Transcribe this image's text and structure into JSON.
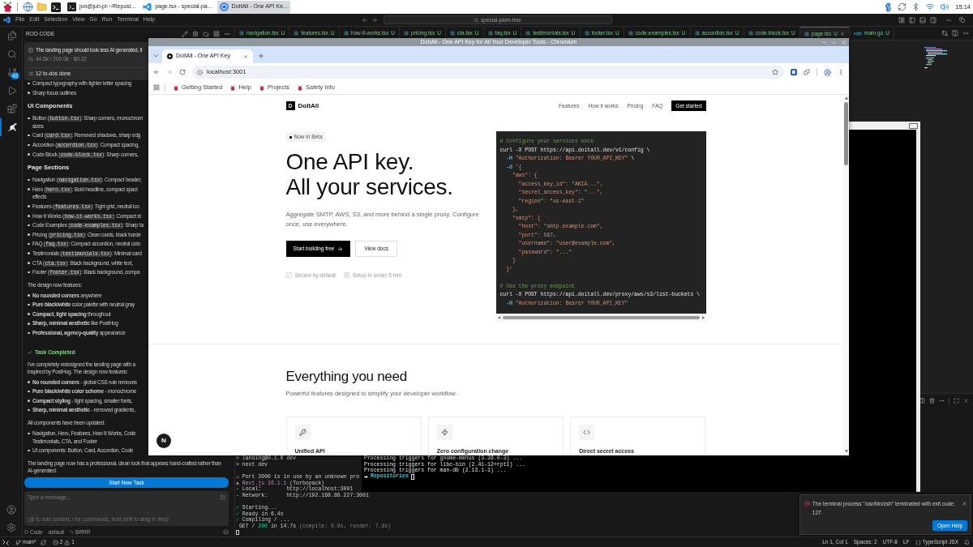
{
  "taskbar": {
    "windows": [
      {
        "kind": "terminal",
        "title": "jun@jun-pi:~/Reposi...",
        "selected": false
      },
      {
        "kind": "editor",
        "title": "page.tsx - special-pa...",
        "selected": false
      },
      {
        "kind": "browser",
        "title": "DoItAll - One API Ke...",
        "selected": true
      }
    ],
    "clock": "15:14"
  },
  "editor": {
    "menu": [
      "File",
      "Edit",
      "Selection",
      "View",
      "Go",
      "Run",
      "Terminal",
      "Help"
    ],
    "search": "special-palm-tree",
    "activity": [
      {
        "kind": "files",
        "selected": false
      },
      {
        "kind": "search",
        "selected": false
      },
      {
        "kind": "source-control",
        "selected": false,
        "badge": "45"
      },
      {
        "kind": "run",
        "selected": false
      },
      {
        "kind": "extensions",
        "selected": false
      },
      {
        "kind": "roo",
        "selected": true
      }
    ],
    "tabs": [
      {
        "kind": "tsx",
        "label": "navigation.tsx",
        "status": "U",
        "selected": false
      },
      {
        "kind": "tsx",
        "label": "features.tsx",
        "status": "U",
        "selected": false
      },
      {
        "kind": "tsx",
        "label": "how-it-works.tsx",
        "status": "U",
        "selected": false
      },
      {
        "kind": "tsx",
        "label": "pricing.tsx",
        "status": "U",
        "selected": false
      },
      {
        "kind": "tsx",
        "label": "cta.tsx",
        "status": "U",
        "selected": false
      },
      {
        "kind": "tsx",
        "label": "faq.tsx",
        "status": "U",
        "selected": false
      },
      {
        "kind": "tsx",
        "label": "testimonials.tsx",
        "status": "U",
        "selected": false
      },
      {
        "kind": "tsx",
        "label": "footer.tsx",
        "status": "U",
        "selected": false
      },
      {
        "kind": "tsx",
        "label": "code-examples.tsx",
        "status": "U",
        "selected": false
      },
      {
        "kind": "tsx",
        "label": "accordion.tsx",
        "status": "U",
        "selected": false
      },
      {
        "kind": "tsx",
        "label": "code-block.tsx",
        "status": "U",
        "selected": false
      },
      {
        "kind": "tsx",
        "label": "page.tsx",
        "status": "U",
        "selected": true
      },
      {
        "kind": "go",
        "label": "main.go",
        "status": "U",
        "selected": false
      }
    ]
  },
  "roo": {
    "title": "ROO CODE",
    "task": "The landing page should look less AI generated, it",
    "usage": "44.8k / 200.0k · $0.22",
    "todos": "12 to-dos done",
    "blocks": [
      {
        "kind": "bullet",
        "parts": [
          {
            "text": "Compact typography with tighter letter spacing"
          }
        ]
      },
      {
        "kind": "bullet",
        "parts": [
          {
            "text": "Sharp focus outlines"
          }
        ]
      },
      {
        "kind": "heading",
        "text": "UI Components"
      },
      {
        "kind": "bullet",
        "parts": [
          {
            "text": "Button ("
          },
          {
            "code": "button.tsx"
          },
          {
            "text": "): Sharp corners, monochrom"
          }
        ],
        "more": "sizes"
      },
      {
        "kind": "bullet",
        "parts": [
          {
            "text": "Card ("
          },
          {
            "code": "card.tsx"
          },
          {
            "text": "): Removed shadows, sharp edg"
          }
        ]
      },
      {
        "kind": "bullet",
        "parts": [
          {
            "text": "Accordion ("
          },
          {
            "code": "accordion.tsx"
          },
          {
            "text": "): Compact spacing,"
          }
        ]
      },
      {
        "kind": "bullet",
        "parts": [
          {
            "text": "Code Block ("
          },
          {
            "code": "code-block.tsx"
          },
          {
            "text": "): Sharp corners,"
          }
        ]
      },
      {
        "kind": "heading",
        "text": "Page Sections"
      },
      {
        "kind": "bullet",
        "parts": [
          {
            "text": "Navigation ("
          },
          {
            "code": "navigation.tsx"
          },
          {
            "text": "): Compact header,"
          }
        ]
      },
      {
        "kind": "bullet",
        "parts": [
          {
            "text": "Hero ("
          },
          {
            "code": "hero.tsx"
          },
          {
            "text": "): Bold headline, compact spaci"
          }
        ],
        "more": "effects"
      },
      {
        "kind": "bullet",
        "parts": [
          {
            "text": "Features ("
          },
          {
            "code": "features.tsx"
          },
          {
            "text": "): Tight grid, neutral ico"
          }
        ]
      },
      {
        "kind": "bullet",
        "parts": [
          {
            "text": "How It Works ("
          },
          {
            "code": "how-it-works.tsx"
          },
          {
            "text": "): Compact st"
          }
        ]
      },
      {
        "kind": "bullet",
        "parts": [
          {
            "text": "Code Examples ("
          },
          {
            "code": "code-examples.tsx"
          },
          {
            "text": "): Sharp ta"
          }
        ]
      },
      {
        "kind": "bullet",
        "parts": [
          {
            "text": "Pricing ("
          },
          {
            "code": "pricing.tsx"
          },
          {
            "text": "): Clean cards, black borde"
          }
        ]
      },
      {
        "kind": "bullet",
        "parts": [
          {
            "text": "FAQ ("
          },
          {
            "code": "faq.tsx"
          },
          {
            "text": "): Compact accordion, neutral colo"
          }
        ]
      },
      {
        "kind": "bullet",
        "parts": [
          {
            "text": "Testimonials ("
          },
          {
            "code": "testimonials.tsx"
          },
          {
            "text": "): Minimal card"
          }
        ]
      },
      {
        "kind": "bullet",
        "parts": [
          {
            "text": "CTA ("
          },
          {
            "code": "cta.tsx"
          },
          {
            "text": "): Black background, white text,"
          }
        ]
      },
      {
        "kind": "bullet",
        "parts": [
          {
            "text": "Footer ("
          },
          {
            "code": "footer.tsx"
          },
          {
            "text": "): Black background, compa"
          }
        ]
      },
      {
        "kind": "paragraph",
        "text": "The design now features:"
      },
      {
        "kind": "bullet",
        "parts": [
          {
            "text": "**No rounded corners** anywhere"
          }
        ]
      },
      {
        "kind": "bullet",
        "parts": [
          {
            "text": "**Pure black/white** color palette with neutral gray"
          }
        ]
      },
      {
        "kind": "bullet",
        "parts": [
          {
            "text": "**Compact, tight spacing** throughout"
          }
        ]
      },
      {
        "kind": "bullet",
        "parts": [
          {
            "text": "**Sharp, minimal aesthetic** like PostHog"
          }
        ]
      },
      {
        "kind": "bullet",
        "parts": [
          {
            "text": "**Professional, agency-quality** appearance"
          }
        ]
      },
      {
        "kind": "status",
        "text": "Task Completed"
      },
      {
        "kind": "paragraph",
        "text": "I've completely redesigned the landing page with a",
        "more": "inspired by PostHog. The design now features:"
      },
      {
        "kind": "bullet",
        "parts": [
          {
            "text": "**No rounded corners** - global CSS rule removes"
          }
        ]
      },
      {
        "kind": "bullet",
        "parts": [
          {
            "text": "**Pure black/white color scheme** - monochrome"
          }
        ]
      },
      {
        "kind": "bullet",
        "parts": [
          {
            "text": "**Compact styling** - tight spacing, smaller fonts,"
          }
        ]
      },
      {
        "kind": "bullet",
        "parts": [
          {
            "text": "**Sharp, minimal aesthetic** - removed gradients,"
          }
        ]
      },
      {
        "kind": "paragraph",
        "text": "All components have been updated:"
      },
      {
        "kind": "bullet",
        "parts": [
          {
            "text": "Navigation, Hero, Features, How It Works, Code"
          }
        ],
        "more": "Testimonials, CTA, and Footer"
      },
      {
        "kind": "bullet",
        "parts": [
          {
            "text": "UI components: Button, Card, Accordion, Code"
          }
        ]
      },
      {
        "kind": "paragraph",
        "text": "The landing page now has a professional, clean look that appears hand-crafted rather than AI-generated."
      }
    ],
    "action": "Start New Task",
    "input": {
      "placeholder": "Type a message...",
      "hint": "(@ to add context, / for commands, hold shift to drag in files)"
    },
    "mode": "Code",
    "config": "default",
    "model": "BRRR"
  },
  "terminal": {
    "groups": [
      [
        [
          {
            "kind": "plain",
            "text": "> landing@0.1.0 dev"
          }
        ],
        [
          {
            "kind": "plain",
            "text": "> next dev"
          }
        ]
      ],
      [
        [
          {
            "kind": "warn",
            "text": "⚠"
          },
          {
            "kind": "plain",
            "text": " Port 3000 is in use by an unknown pro"
          }
        ],
        [
          {
            "kind": "accent",
            "text": "▲ Next.js 16.1.1"
          },
          {
            "kind": "plain",
            "text": " (Turbopack)"
          }
        ],
        [
          {
            "kind": "plain",
            "text": "- Local:        http://localhost:3001"
          }
        ],
        [
          {
            "kind": "plain",
            "text": "- Network:      http://192.168.86.227:3001"
          }
        ]
      ],
      [
        [
          {
            "kind": "ok",
            "text": "✓"
          },
          {
            "kind": "plain",
            "text": " Starting..."
          }
        ],
        [
          {
            "kind": "ok",
            "text": "✓"
          },
          {
            "kind": "plain",
            "text": " Ready in 6.4s"
          }
        ],
        [
          {
            "kind": "muted",
            "text": "○"
          },
          {
            "kind": "plain",
            "text": " Compiling / ..."
          }
        ],
        [
          {
            "kind": "plain",
            "text": " GET / "
          },
          {
            "kind": "ok",
            "text": "200"
          },
          {
            "kind": "plain",
            "text": " in 14.7s "
          },
          {
            "kind": "muted",
            "text": "(compile: 6.9s, render: 7.8s)"
          }
        ]
      ]
    ]
  },
  "notification": {
    "message": "The terminal process \"/usr/bin/zsh\" terminated with exit code: 127.",
    "button": "Open Help"
  },
  "status_bar": {
    "branch": "main*",
    "errors": "2",
    "warnings": "1",
    "items": [
      "Ln 1, Col 1",
      "Spaces: 2",
      "UTF-8",
      "LF"
    ],
    "language": "TypeScript JSX"
  },
  "terminal_window": {
    "lines": [
      "Processing triggers for gnome-menus (3.36.0-3) ...",
      "Processing triggers for libc-bin (2.41-12+rpt1) ...",
      "Processing triggers for man-db (2.13.1-1) ..."
    ],
    "prompt": "Repositories"
  },
  "browser": {
    "title": "DoItAll - One API Key for All Your Developer Tools - Chromium",
    "tab": "DoItAll - One API Key",
    "url": "localhost:3001",
    "bookmarks": [
      "Getting Started",
      "Help",
      "Projects",
      "Safety Info"
    ],
    "page": {
      "logo": "D",
      "brand": "DoItAll",
      "nav": [
        "Features",
        "How it works",
        "Pricing",
        "FAQ"
      ],
      "cta": "Get started",
      "badge": "Now in Beta",
      "headline": [
        "One API key.",
        "All your services."
      ],
      "lead": "Aggregate SMTP, AWS, S3, and more behind a single proxy. Configure once, use everywhere.",
      "buttons": [
        {
          "kind": "primary",
          "label": "Start building free"
        },
        {
          "kind": "secondary",
          "label": "View docs"
        }
      ],
      "checks": [
        {
          "kind": "check",
          "text": "Secure by default"
        },
        {
          "kind": "bolt",
          "text": "Setup in under 5 min"
        }
      ],
      "code": [
        [
          [
            {
              "kind": "comment",
              "text": "# Configure your services once"
            }
          ],
          [
            {
              "kind": "plain",
              "text": "curl -X POST https://api.doitall.dev/v1/config \\"
            }
          ],
          [
            {
              "kind": "flag",
              "text": "  -H "
            },
            {
              "kind": "string",
              "text": "\"Authorization: Bearer YOUR_API_KEY\""
            },
            {
              "kind": "plain",
              "text": " \\"
            }
          ],
          [
            {
              "kind": "flag",
              "text": "  -d "
            },
            {
              "kind": "string",
              "text": "'{"
            }
          ],
          [
            {
              "kind": "string",
              "text": "    \"aws\": {"
            }
          ],
          [
            {
              "kind": "string",
              "text": "      \"access_key_id\": \"AKIA...\","
            }
          ],
          [
            {
              "kind": "string",
              "text": "      \"secret_access_key\": \"...\","
            }
          ],
          [
            {
              "kind": "string",
              "text": "      \"region\": \"us-east-1\""
            }
          ],
          [
            {
              "kind": "string",
              "text": "    },"
            }
          ],
          [
            {
              "kind": "string",
              "text": "    \"smtp\": {"
            }
          ],
          [
            {
              "kind": "string",
              "text": "      \"host\": \"smtp.example.com\","
            }
          ],
          [
            {
              "kind": "string",
              "text": "      \"port\": 587,"
            }
          ],
          [
            {
              "kind": "string",
              "text": "      \"username\": \"user@example.com\","
            }
          ],
          [
            {
              "kind": "string",
              "text": "      \"password\": \"...\""
            }
          ],
          [
            {
              "kind": "string",
              "text": "    }"
            }
          ],
          [
            {
              "kind": "string",
              "text": "  }'"
            }
          ]
        ],
        [
          [
            {
              "kind": "comment",
              "text": "# Use the proxy endpoint"
            }
          ],
          [
            {
              "kind": "plain",
              "text": "curl -X POST https://api.doitall.dev/proxy/aws/s3/list-buckets \\"
            }
          ],
          [
            {
              "kind": "flag",
              "text": "  -H "
            },
            {
              "kind": "string",
              "text": "\"Authorization: Bearer YOUR_API_KEY\""
            }
          ]
        ]
      ],
      "section": {
        "title": "Everything you need",
        "subtitle": "Powerful features designed to simplify your developer workflow.",
        "cards": [
          {
            "kind": "key",
            "title": "Unified API"
          },
          {
            "kind": "zap",
            "title": "Zero configuration change"
          },
          {
            "kind": "code",
            "title": "Direct secret access"
          }
        ]
      },
      "dev_badge": "N"
    }
  }
}
